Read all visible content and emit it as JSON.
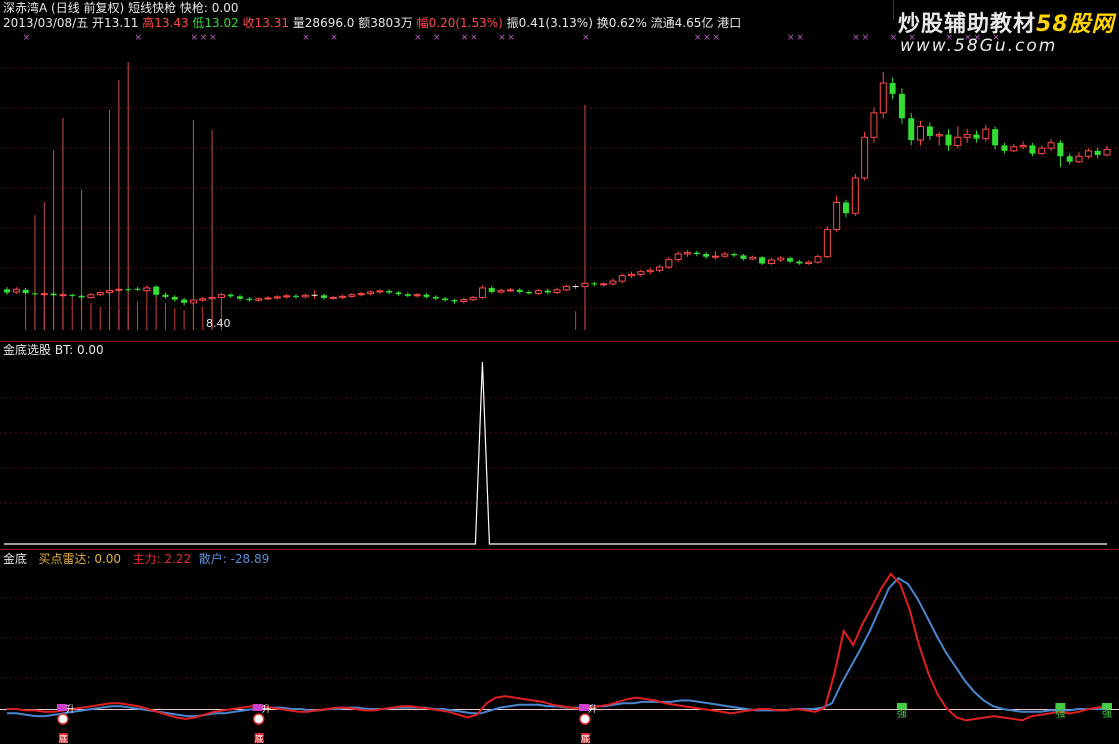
{
  "watermark": {
    "line1_prefix": "炒股辅助教材",
    "line1_brand": "58股网",
    "line2": "www.58Gu.com"
  },
  "header1": {
    "name": "深赤湾A",
    "params": "(日线 前复权)",
    "indicator": "短线快枪",
    "value_label": "快枪: 0.00"
  },
  "header2": {
    "date": "2013/03/08/五",
    "open": "开13.11",
    "high": "高13.43",
    "low": "低13.02",
    "close": "收13.31",
    "volume": "量28696.0",
    "amount": "额3803万",
    "change": "幅0.20(1.53%)",
    "amplitude": "振0.41(3.13%)",
    "turnover": "换0.62%",
    "float_cap": "流通4.65亿",
    "region": "港口"
  },
  "panel2": {
    "name": "金底选股",
    "value": "BT: 0.00"
  },
  "panel3": {
    "name": "金底",
    "buy_radar": "买点雷达: 0.00",
    "main_force": "主力: 2.22",
    "retail": "散户: -28.89"
  },
  "low_price_label": "8.40",
  "marker_labels": {
    "buy": "底",
    "chip": "升",
    "trend": "强"
  },
  "colors": {
    "up": "#ff4a4a",
    "down": "#33dd33",
    "main_line": "#e02020",
    "retail_line": "#4a86d0",
    "signal": "#ffffff"
  },
  "chart_data": [
    {
      "type": "candlestick",
      "title": "深赤湾A",
      "y_range": [
        8.4,
        18.2
      ],
      "candles": [
        {
          "o": 9.9,
          "c": 9.78,
          "h": 9.98,
          "l": 9.7
        },
        {
          "o": 9.8,
          "c": 9.9,
          "h": 9.98,
          "l": 9.72
        },
        {
          "o": 9.88,
          "c": 9.76,
          "h": 9.95,
          "l": 9.68
        },
        {
          "o": 9.75,
          "c": 9.72,
          "h": 9.8,
          "l": 9.66
        },
        {
          "o": 9.72,
          "c": 9.74,
          "h": 9.8,
          "l": 9.66
        },
        {
          "o": 9.74,
          "c": 9.68,
          "h": 9.8,
          "l": 9.62
        },
        {
          "o": 9.68,
          "c": 9.7,
          "h": 9.76,
          "l": 9.62
        },
        {
          "o": 9.7,
          "c": 9.66,
          "h": 9.74,
          "l": 9.6
        },
        {
          "o": 9.66,
          "c": 9.6,
          "h": 9.7,
          "l": 9.52
        },
        {
          "o": 9.6,
          "c": 9.7,
          "h": 9.76,
          "l": 9.55
        },
        {
          "o": 9.7,
          "c": 9.78,
          "h": 9.82,
          "l": 9.64
        },
        {
          "o": 9.78,
          "c": 9.86,
          "h": 9.9,
          "l": 9.72
        },
        {
          "o": 9.86,
          "c": 9.9,
          "h": 9.96,
          "l": 9.8
        },
        {
          "o": 9.9,
          "c": 9.88,
          "h": 9.98,
          "l": 9.82
        },
        {
          "o": 9.92,
          "c": 9.88,
          "h": 9.98,
          "l": 9.84
        },
        {
          "o": 9.85,
          "c": 9.95,
          "h": 10.05,
          "l": 9.8
        },
        {
          "o": 10.0,
          "c": 9.7,
          "h": 10.05,
          "l": 9.62
        },
        {
          "o": 9.7,
          "c": 9.62,
          "h": 9.78,
          "l": 9.55
        },
        {
          "o": 9.62,
          "c": 9.52,
          "h": 9.68,
          "l": 9.44
        },
        {
          "o": 9.52,
          "c": 9.4,
          "h": 9.58,
          "l": 9.3
        },
        {
          "o": 9.4,
          "c": 9.5,
          "h": 9.55,
          "l": 9.28
        },
        {
          "o": 9.5,
          "c": 9.55,
          "h": 9.62,
          "l": 9.44
        },
        {
          "o": 9.55,
          "c": 9.6,
          "h": 9.66,
          "l": 9.5
        },
        {
          "o": 9.6,
          "c": 9.7,
          "h": 9.76,
          "l": 9.54
        },
        {
          "o": 9.7,
          "c": 9.64,
          "h": 9.76,
          "l": 9.58
        },
        {
          "o": 9.64,
          "c": 9.55,
          "h": 9.7,
          "l": 9.48
        },
        {
          "o": 9.55,
          "c": 9.5,
          "h": 9.62,
          "l": 9.44
        },
        {
          "o": 9.5,
          "c": 9.55,
          "h": 9.6,
          "l": 9.44
        },
        {
          "o": 9.55,
          "c": 9.58,
          "h": 9.64,
          "l": 9.5
        },
        {
          "o": 9.58,
          "c": 9.62,
          "h": 9.68,
          "l": 9.52
        },
        {
          "o": 9.62,
          "c": 9.66,
          "h": 9.72,
          "l": 9.56
        },
        {
          "o": 9.66,
          "c": 9.62,
          "h": 9.72,
          "l": 9.56
        },
        {
          "o": 9.62,
          "c": 9.68,
          "h": 9.74,
          "l": 9.56
        },
        {
          "o": 9.68,
          "c": 9.68,
          "h": 9.86,
          "l": 9.55
        },
        {
          "o": 9.68,
          "c": 9.58,
          "h": 9.74,
          "l": 9.52
        },
        {
          "o": 9.58,
          "c": 9.6,
          "h": 9.66,
          "l": 9.52
        },
        {
          "o": 9.6,
          "c": 9.64,
          "h": 9.7,
          "l": 9.54
        },
        {
          "o": 9.64,
          "c": 9.7,
          "h": 9.76,
          "l": 9.58
        },
        {
          "o": 9.7,
          "c": 9.74,
          "h": 9.8,
          "l": 9.64
        },
        {
          "o": 9.74,
          "c": 9.8,
          "h": 9.86,
          "l": 9.68
        },
        {
          "o": 9.8,
          "c": 9.84,
          "h": 9.9,
          "l": 9.74
        },
        {
          "o": 9.84,
          "c": 9.78,
          "h": 9.9,
          "l": 9.72
        },
        {
          "o": 9.78,
          "c": 9.72,
          "h": 9.84,
          "l": 9.66
        },
        {
          "o": 9.72,
          "c": 9.66,
          "h": 9.78,
          "l": 9.6
        },
        {
          "o": 9.66,
          "c": 9.7,
          "h": 9.76,
          "l": 9.6
        },
        {
          "o": 9.7,
          "c": 9.62,
          "h": 9.76,
          "l": 9.56
        },
        {
          "o": 9.62,
          "c": 9.56,
          "h": 9.68,
          "l": 9.5
        },
        {
          "o": 9.56,
          "c": 9.5,
          "h": 9.62,
          "l": 9.44
        },
        {
          "o": 9.5,
          "c": 9.45,
          "h": 9.56,
          "l": 9.36
        },
        {
          "o": 9.45,
          "c": 9.52,
          "h": 9.58,
          "l": 9.38
        },
        {
          "o": 9.52,
          "c": 9.6,
          "h": 9.66,
          "l": 9.46
        },
        {
          "o": 9.6,
          "c": 9.95,
          "h": 10.05,
          "l": 9.55
        },
        {
          "o": 9.95,
          "c": 9.8,
          "h": 10.02,
          "l": 9.74
        },
        {
          "o": 9.8,
          "c": 9.86,
          "h": 9.92,
          "l": 9.74
        },
        {
          "o": 9.86,
          "c": 9.88,
          "h": 9.94,
          "l": 9.8
        },
        {
          "o": 9.88,
          "c": 9.8,
          "h": 9.94,
          "l": 9.74
        },
        {
          "o": 9.8,
          "c": 9.75,
          "h": 9.86,
          "l": 9.7
        },
        {
          "o": 9.75,
          "c": 9.85,
          "h": 9.92,
          "l": 9.7
        },
        {
          "o": 9.85,
          "c": 9.78,
          "h": 9.92,
          "l": 9.72
        },
        {
          "o": 9.78,
          "c": 9.88,
          "h": 9.96,
          "l": 9.72
        },
        {
          "o": 9.88,
          "c": 10.0,
          "h": 10.06,
          "l": 9.82
        },
        {
          "o": 10.0,
          "c": 10.0,
          "h": 10.1,
          "l": 9.9
        },
        {
          "o": 10.0,
          "c": 10.12,
          "h": 10.18,
          "l": 9.94
        },
        {
          "o": 10.12,
          "c": 10.08,
          "h": 10.18,
          "l": 10.0
        },
        {
          "o": 10.08,
          "c": 10.1,
          "h": 10.16,
          "l": 10.0
        },
        {
          "o": 10.1,
          "c": 10.2,
          "h": 10.3,
          "l": 10.04
        },
        {
          "o": 10.2,
          "c": 10.4,
          "h": 10.48,
          "l": 10.12
        },
        {
          "o": 10.4,
          "c": 10.45,
          "h": 10.55,
          "l": 10.32
        },
        {
          "o": 10.45,
          "c": 10.55,
          "h": 10.62,
          "l": 10.36
        },
        {
          "o": 10.55,
          "c": 10.6,
          "h": 10.7,
          "l": 10.46
        },
        {
          "o": 10.6,
          "c": 10.72,
          "h": 10.8,
          "l": 10.52
        },
        {
          "o": 10.72,
          "c": 11.0,
          "h": 11.1,
          "l": 10.64
        },
        {
          "o": 11.0,
          "c": 11.2,
          "h": 11.3,
          "l": 10.9
        },
        {
          "o": 11.2,
          "c": 11.25,
          "h": 11.34,
          "l": 11.1
        },
        {
          "o": 11.25,
          "c": 11.2,
          "h": 11.32,
          "l": 11.12
        },
        {
          "o": 11.2,
          "c": 11.1,
          "h": 11.28,
          "l": 11.02
        },
        {
          "o": 11.1,
          "c": 11.12,
          "h": 11.3,
          "l": 11.0
        },
        {
          "o": 11.12,
          "c": 11.2,
          "h": 11.28,
          "l": 11.06
        },
        {
          "o": 11.2,
          "c": 11.15,
          "h": 11.26,
          "l": 11.08
        },
        {
          "o": 11.15,
          "c": 11.02,
          "h": 11.2,
          "l": 10.96
        },
        {
          "o": 11.02,
          "c": 11.08,
          "h": 11.14,
          "l": 10.98
        },
        {
          "o": 11.08,
          "c": 10.85,
          "h": 11.12,
          "l": 10.8
        },
        {
          "o": 10.85,
          "c": 10.98,
          "h": 11.06,
          "l": 10.8
        },
        {
          "o": 10.98,
          "c": 11.05,
          "h": 11.12,
          "l": 10.9
        },
        {
          "o": 11.05,
          "c": 10.92,
          "h": 11.1,
          "l": 10.86
        },
        {
          "o": 10.92,
          "c": 10.85,
          "h": 10.98,
          "l": 10.8
        },
        {
          "o": 10.85,
          "c": 10.9,
          "h": 10.96,
          "l": 10.8
        },
        {
          "o": 10.9,
          "c": 11.1,
          "h": 11.18,
          "l": 10.84
        },
        {
          "o": 11.1,
          "c": 12.1,
          "h": 12.22,
          "l": 11.05
        },
        {
          "o": 12.1,
          "c": 13.1,
          "h": 13.35,
          "l": 12.0
        },
        {
          "o": 13.1,
          "c": 12.7,
          "h": 13.2,
          "l": 12.55
        },
        {
          "o": 12.7,
          "c": 14.0,
          "h": 14.15,
          "l": 12.6
        },
        {
          "o": 14.0,
          "c": 15.5,
          "h": 15.7,
          "l": 13.9
        },
        {
          "o": 15.5,
          "c": 16.4,
          "h": 16.6,
          "l": 15.3
        },
        {
          "o": 16.4,
          "c": 17.5,
          "h": 17.9,
          "l": 16.2
        },
        {
          "o": 17.5,
          "c": 17.1,
          "h": 17.7,
          "l": 16.9
        },
        {
          "o": 17.1,
          "c": 16.2,
          "h": 17.3,
          "l": 16.0
        },
        {
          "o": 16.2,
          "c": 15.4,
          "h": 16.4,
          "l": 15.2
        },
        {
          "o": 15.4,
          "c": 15.9,
          "h": 16.1,
          "l": 15.2
        },
        {
          "o": 15.9,
          "c": 15.55,
          "h": 16.05,
          "l": 15.4
        },
        {
          "o": 15.55,
          "c": 15.6,
          "h": 15.7,
          "l": 15.2
        },
        {
          "o": 15.6,
          "c": 15.2,
          "h": 15.8,
          "l": 15.0
        },
        {
          "o": 15.2,
          "c": 15.5,
          "h": 15.9,
          "l": 15.1
        },
        {
          "o": 15.5,
          "c": 15.6,
          "h": 15.8,
          "l": 15.3
        },
        {
          "o": 15.6,
          "c": 15.45,
          "h": 15.75,
          "l": 15.3
        },
        {
          "o": 15.45,
          "c": 15.8,
          "h": 15.95,
          "l": 15.35
        },
        {
          "o": 15.8,
          "c": 15.2,
          "h": 15.9,
          "l": 15.05
        },
        {
          "o": 15.2,
          "c": 15.0,
          "h": 15.3,
          "l": 14.9
        },
        {
          "o": 15.0,
          "c": 15.15,
          "h": 15.25,
          "l": 14.95
        },
        {
          "o": 15.15,
          "c": 15.2,
          "h": 15.35,
          "l": 15.05
        },
        {
          "o": 15.2,
          "c": 14.9,
          "h": 15.3,
          "l": 14.8
        },
        {
          "o": 14.9,
          "c": 15.1,
          "h": 15.2,
          "l": 14.85
        },
        {
          "o": 15.1,
          "c": 15.3,
          "h": 15.45,
          "l": 15.0
        },
        {
          "o": 15.3,
          "c": 14.8,
          "h": 15.4,
          "l": 14.4
        },
        {
          "o": 14.8,
          "c": 14.6,
          "h": 14.9,
          "l": 14.5
        },
        {
          "o": 14.6,
          "c": 14.8,
          "h": 14.95,
          "l": 14.55
        },
        {
          "o": 14.8,
          "c": 15.0,
          "h": 15.1,
          "l": 14.7
        },
        {
          "o": 15.0,
          "c": 14.85,
          "h": 15.12,
          "l": 14.72
        },
        {
          "o": 14.85,
          "c": 15.05,
          "h": 15.2,
          "l": 14.8
        }
      ]
    },
    {
      "type": "line",
      "title": "金底选股",
      "series": [
        {
          "name": "BT",
          "spike_at_candle": 51
        }
      ]
    },
    {
      "type": "line",
      "title": "金底",
      "series": [
        {
          "name": "主力",
          "values": [
            0,
            0,
            -1,
            -1,
            -2,
            -2,
            -1,
            0,
            1,
            2,
            3,
            4,
            4,
            3,
            2,
            0,
            -2,
            -4,
            -6,
            -7,
            -6,
            -4,
            -2,
            -1,
            0,
            1,
            2,
            2,
            1,
            0,
            -1,
            -2,
            -2,
            -1,
            0,
            1,
            1,
            0,
            -1,
            -1,
            0,
            1,
            2,
            2,
            1,
            0,
            -1,
            -2,
            -4,
            -6,
            -4,
            4,
            8,
            9,
            8,
            7,
            6,
            5,
            3,
            2,
            1,
            0,
            1,
            2,
            3,
            5,
            7,
            8,
            7,
            6,
            4,
            3,
            2,
            1,
            0,
            -1,
            -2,
            -3,
            -2,
            -1,
            0,
            0,
            -1,
            -1,
            0,
            -1,
            -2,
            1,
            25,
            55,
            45,
            60,
            72,
            85,
            95,
            88,
            70,
            45,
            25,
            10,
            0,
            -6,
            -8,
            -7,
            -6,
            -5,
            -6,
            -7,
            -8,
            -5,
            -4,
            -3,
            -2,
            -3,
            -2,
            0,
            1,
            2
          ]
        },
        {
          "name": "散户",
          "values": [
            -3,
            -3,
            -4,
            -5,
            -5,
            -4,
            -3,
            -2,
            -1,
            0,
            1,
            2,
            2,
            1,
            0,
            -1,
            -2,
            -3,
            -4,
            -5,
            -5,
            -4,
            -3,
            -3,
            -2,
            -1,
            0,
            1,
            1,
            1,
            0,
            0,
            -1,
            -1,
            0,
            0,
            1,
            1,
            0,
            0,
            0,
            1,
            1,
            1,
            1,
            0,
            0,
            -1,
            -2,
            -3,
            -3,
            -1,
            1,
            2,
            3,
            3,
            3,
            2,
            2,
            1,
            1,
            1,
            2,
            2,
            3,
            4,
            4,
            5,
            5,
            5,
            5,
            6,
            6,
            5,
            4,
            3,
            2,
            1,
            0,
            -1,
            -1,
            -1,
            -1,
            0,
            0,
            0,
            1,
            4,
            18,
            30,
            42,
            55,
            70,
            85,
            92,
            88,
            78,
            65,
            52,
            40,
            30,
            20,
            12,
            6,
            2,
            0,
            -1,
            -2,
            -2,
            -2,
            -1,
            -1,
            -1,
            0,
            0,
            0,
            0
          ]
        }
      ],
      "signals": [
        {
          "label": "底",
          "at": 6
        },
        {
          "label": "升",
          "at": 6
        },
        {
          "label": "底",
          "at": 27
        },
        {
          "label": "升",
          "at": 27
        },
        {
          "label": "底",
          "at": 62
        },
        {
          "label": "升",
          "at": 62
        },
        {
          "label": "强",
          "at": 96
        },
        {
          "label": "强",
          "at": 113
        },
        {
          "label": "强",
          "at": 118
        },
        {
          "label": "底",
          "at": 141
        },
        {
          "label": "升",
          "at": 141
        }
      ]
    }
  ]
}
